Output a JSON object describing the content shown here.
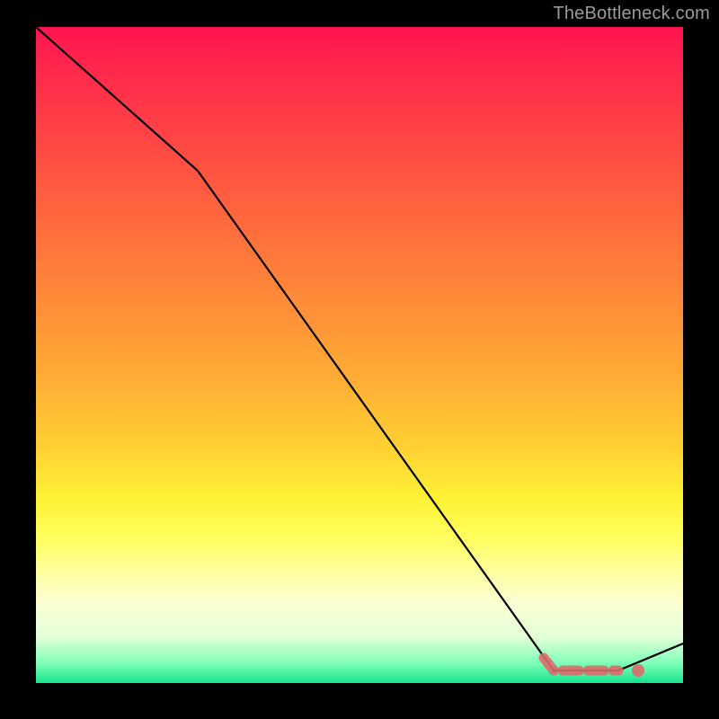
{
  "attribution": "TheBottleneck.com",
  "chart_data": {
    "type": "line",
    "title": "",
    "xlabel": "",
    "ylabel": "",
    "xlim": [
      0,
      100
    ],
    "ylim": [
      0,
      100
    ],
    "series": [
      {
        "name": "main-curve",
        "x": [
          0,
          25,
          80,
          90,
          100
        ],
        "y": [
          100,
          78,
          2,
          2,
          6
        ]
      }
    ],
    "marker": {
      "x": 93,
      "y": 2
    },
    "gradient_stops": [
      {
        "pos": 0.0,
        "color": "#ff1450"
      },
      {
        "pos": 0.72,
        "color": "#fff235"
      },
      {
        "pos": 0.97,
        "color": "#7fffb8"
      },
      {
        "pos": 1.0,
        "color": "#15e28c"
      }
    ]
  }
}
